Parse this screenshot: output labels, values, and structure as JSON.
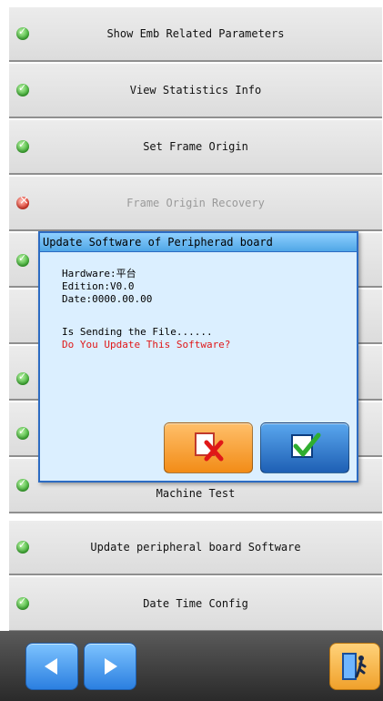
{
  "menu": {
    "items": [
      {
        "label": "Show Emb Related Parameters",
        "status": "enabled"
      },
      {
        "label": "View Statistics Info",
        "status": "enabled"
      },
      {
        "label": "Set Frame Origin",
        "status": "enabled"
      },
      {
        "label": "Frame Origin Recovery",
        "status": "disabled"
      },
      {
        "label": "",
        "status": "enabled"
      },
      {
        "label": "",
        "status": "none"
      },
      {
        "label": "",
        "status": "enabled"
      },
      {
        "label": "",
        "status": "enabled"
      },
      {
        "label": "Machine Test",
        "status": "enabled"
      },
      {
        "label": "Update peripheral board Software",
        "status": "enabled"
      },
      {
        "label": "Date Time Config",
        "status": "enabled"
      }
    ]
  },
  "dialog": {
    "title": "Update Software of Peripherad board",
    "hardware": "Hardware:平台",
    "edition": "Edition:V0.0",
    "date": "Date:0000.00.00",
    "sending": "Is Sending the File......",
    "question": "Do You Update This Software?",
    "cancel_icon": "cancel-icon",
    "confirm_icon": "confirm-icon"
  },
  "bottom_bar": {
    "prev_icon": "left-arrow-icon",
    "next_icon": "right-arrow-icon",
    "exit_icon": "exit-door-icon"
  },
  "colors": {
    "enabled_status": "#3fb234",
    "disabled_status": "#e13a2a",
    "dialog_border": "#2c6bc2",
    "question_text": "#e01818"
  }
}
